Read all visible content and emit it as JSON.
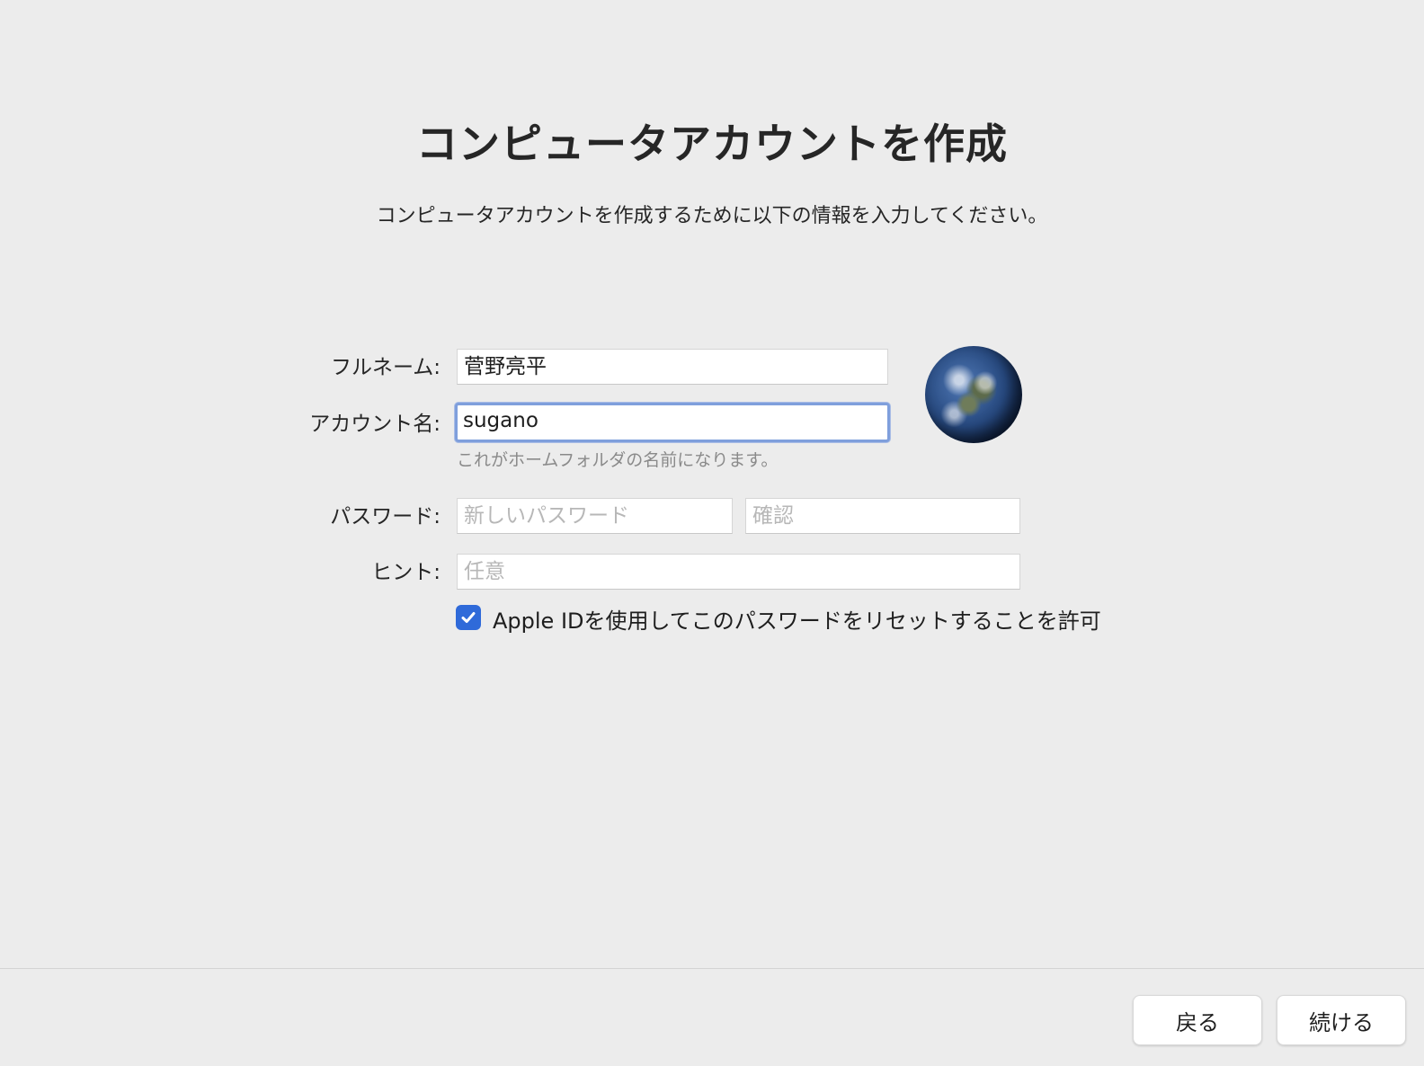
{
  "title": "コンピュータアカウントを作成",
  "subtitle": "コンピュータアカウントを作成するために以下の情報を入力してください。",
  "form": {
    "full_name": {
      "label": "フルネーム:",
      "value": "菅野亮平"
    },
    "account_name": {
      "label": "アカウント名:",
      "value": "sugano",
      "hint": "これがホームフォルダの名前になります。"
    },
    "password": {
      "label": "パスワード:",
      "new_placeholder": "新しいパスワード",
      "confirm_placeholder": "確認"
    },
    "hint": {
      "label": "ヒント:",
      "placeholder": "任意"
    },
    "apple_id_reset": {
      "checked": true,
      "label": "Apple IDを使用してこのパスワードをリセットすることを許可"
    },
    "picture_icon": "earth-globe-icon"
  },
  "footer": {
    "back_label": "戻る",
    "continue_label": "続ける"
  },
  "colors": {
    "background": "#ececec",
    "accent": "#2f6ad9",
    "focus_ring": "#7f9fdc"
  }
}
